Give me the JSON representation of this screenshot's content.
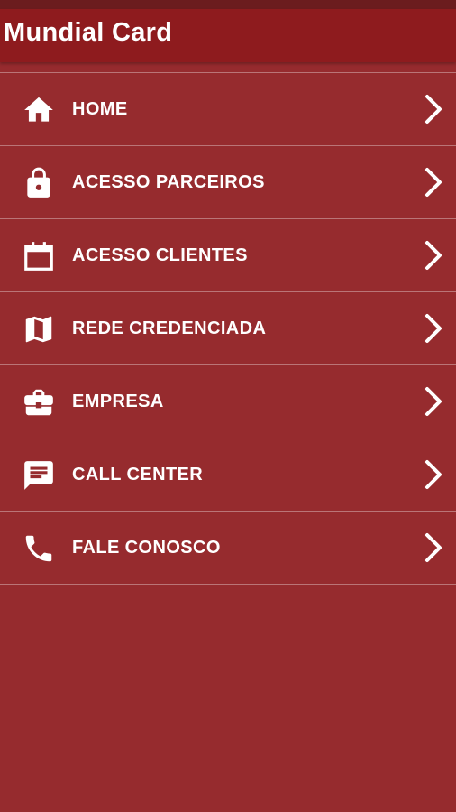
{
  "app_bar": {
    "title": "Mundial Card"
  },
  "menu": {
    "items": [
      {
        "label": "HOME",
        "icon": "home-icon"
      },
      {
        "label": "ACESSO PARCEIROS",
        "icon": "lock-icon"
      },
      {
        "label": "ACESSO CLIENTES",
        "icon": "calendar-icon"
      },
      {
        "label": "REDE CREDENCIADA",
        "icon": "map-icon"
      },
      {
        "label": "EMPRESA",
        "icon": "briefcase-icon"
      },
      {
        "label": "CALL CENTER",
        "icon": "chat-icon"
      },
      {
        "label": "FALE CONOSCO",
        "icon": "phone-icon"
      }
    ],
    "chevron_icon": "chevron-right-icon"
  },
  "colors": {
    "background": "#962b2e",
    "app_bar": "#8e1b1e",
    "status_bar": "#6b1c1e",
    "text": "#ffffff"
  }
}
